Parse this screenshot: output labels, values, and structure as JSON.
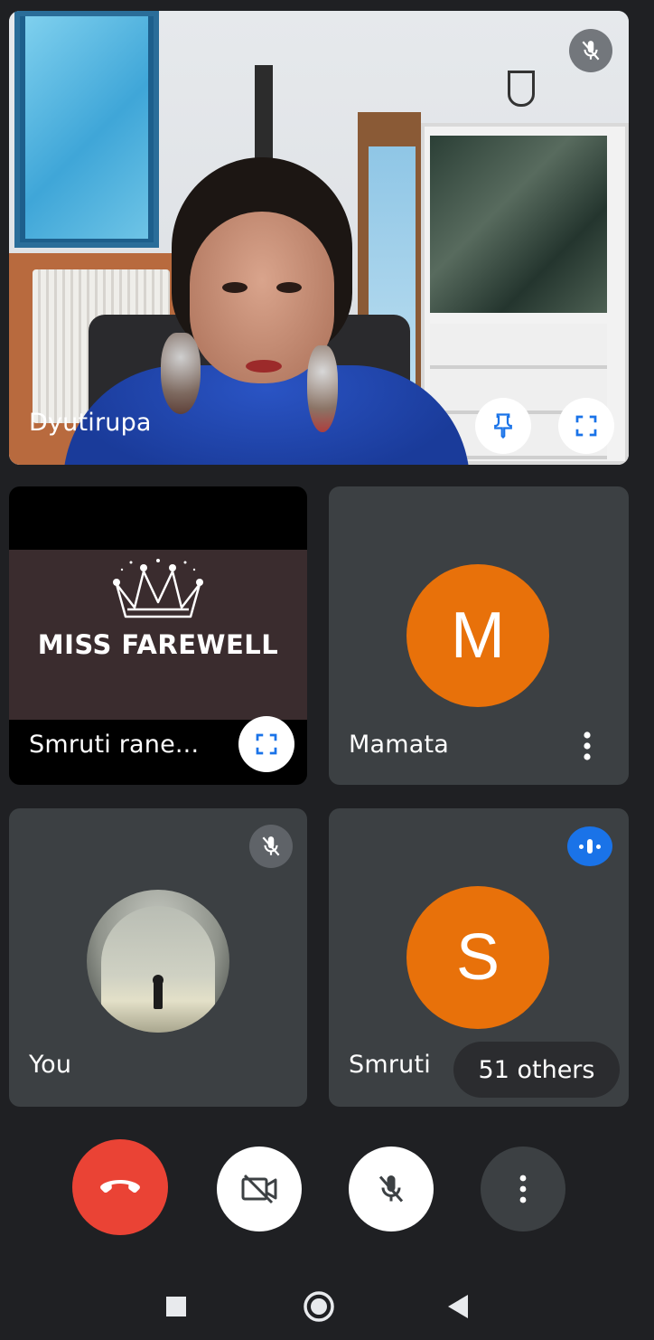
{
  "main_speaker": {
    "name": "Dyutirupa"
  },
  "tiles": [
    {
      "name": "Smruti rane...",
      "banner_text": "MISS FAREWELL"
    },
    {
      "name": "Mamata",
      "avatar_letter": "M"
    },
    {
      "name": "You"
    },
    {
      "name": "Smruti",
      "avatar_letter": "S",
      "others_badge": "51 others"
    }
  ],
  "colors": {
    "background": "#1f2023",
    "tile": "#3c4043",
    "avatar_orange": "#e8710a",
    "end_call_red": "#ea4335",
    "speaking_blue": "#1a73e8",
    "icon_blue": "#1a73e8"
  },
  "icons": {
    "main_muted": "mic-off-icon",
    "pin": "pin-icon",
    "fullscreen": "fullscreen-icon",
    "more": "more-vert-icon",
    "speaking": "audio-level-icon",
    "end_call": "call-end-icon",
    "camera_off": "videocam-off-icon",
    "mic_off": "mic-off-icon",
    "nav_recents": "square-icon",
    "nav_home": "circle-icon",
    "nav_back": "triangle-back-icon"
  }
}
